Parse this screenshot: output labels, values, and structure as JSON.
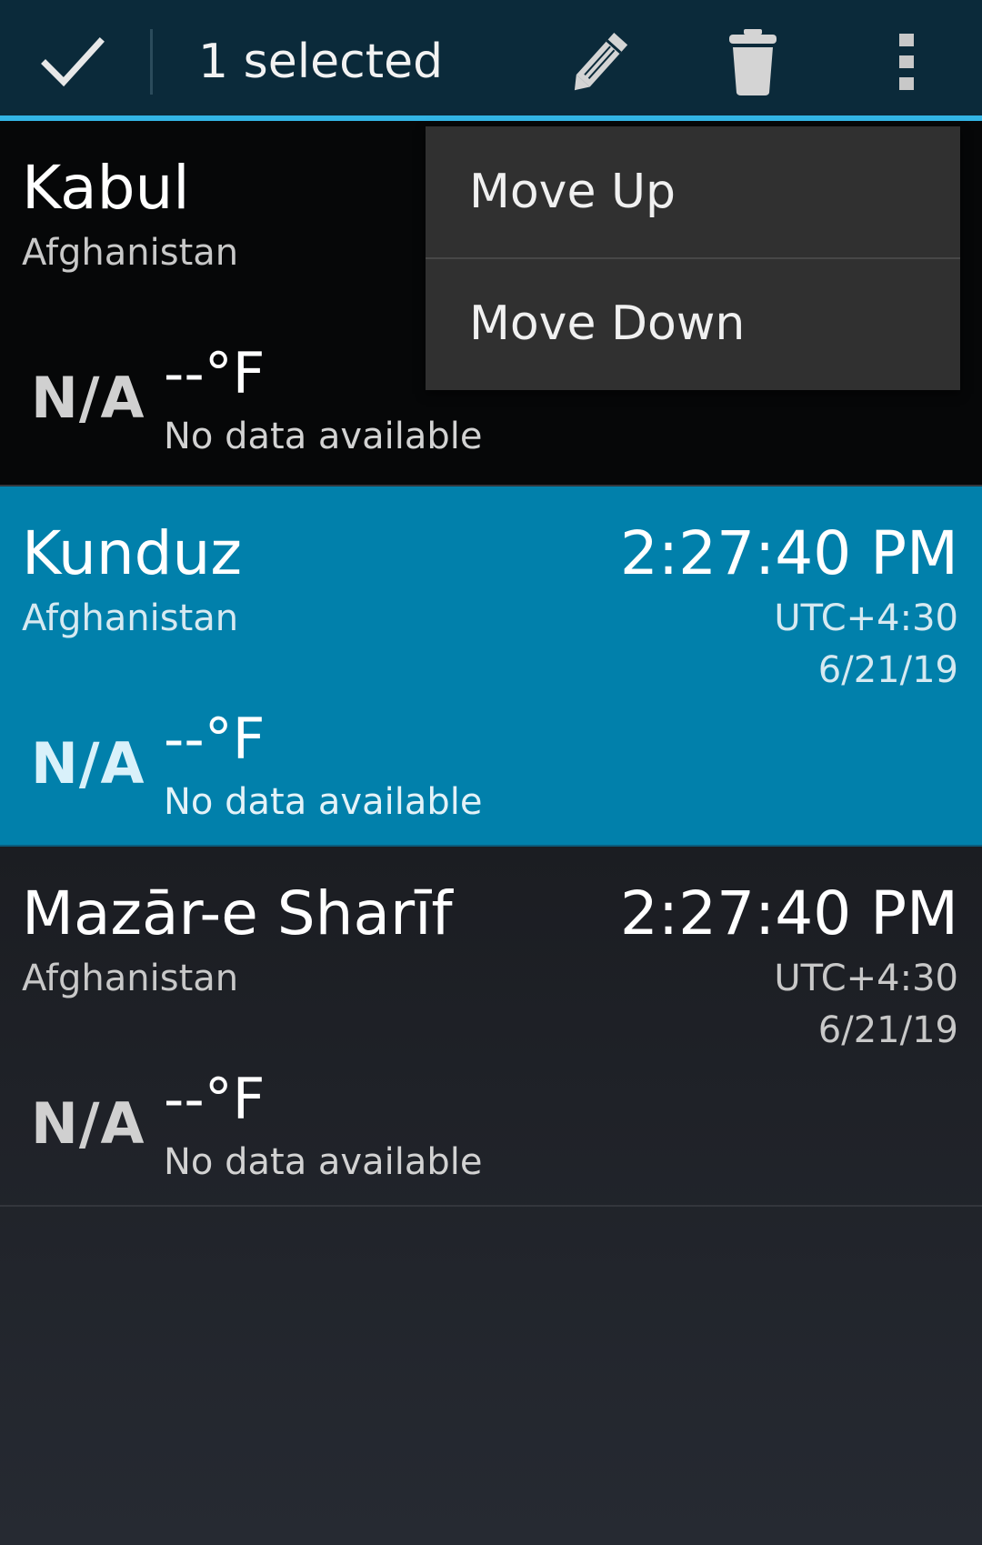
{
  "action_bar": {
    "done_icon": "check-icon",
    "selected_label": "1 selected",
    "edit_icon": "pencil-icon",
    "delete_icon": "trash-icon",
    "overflow_icon": "overflow-menu-icon",
    "accent_color": "#33b5e5",
    "background_color": "#0b2a3a"
  },
  "overflow_menu": {
    "items": [
      {
        "label": "Move Up"
      },
      {
        "label": "Move Down"
      }
    ]
  },
  "cities": [
    {
      "city": "Kabul",
      "country": "Afghanistan",
      "time": "",
      "utc": "",
      "date": "",
      "weather_icon": "N/A",
      "temperature": "--°F",
      "condition": "No data available",
      "selected": false
    },
    {
      "city": "Kunduz",
      "country": "Afghanistan",
      "time": "2:27:40 PM",
      "utc": "UTC+4:30",
      "date": "6/21/19",
      "weather_icon": "N/A",
      "temperature": "--°F",
      "condition": "No data available",
      "selected": true
    },
    {
      "city": "Mazār-e Sharīf",
      "country": "Afghanistan",
      "time": "2:27:40 PM",
      "utc": "UTC+4:30",
      "date": "6/21/19",
      "weather_icon": "N/A",
      "temperature": "--°F",
      "condition": "No data available",
      "selected": false
    }
  ],
  "selected_row_color": "#0180ab"
}
